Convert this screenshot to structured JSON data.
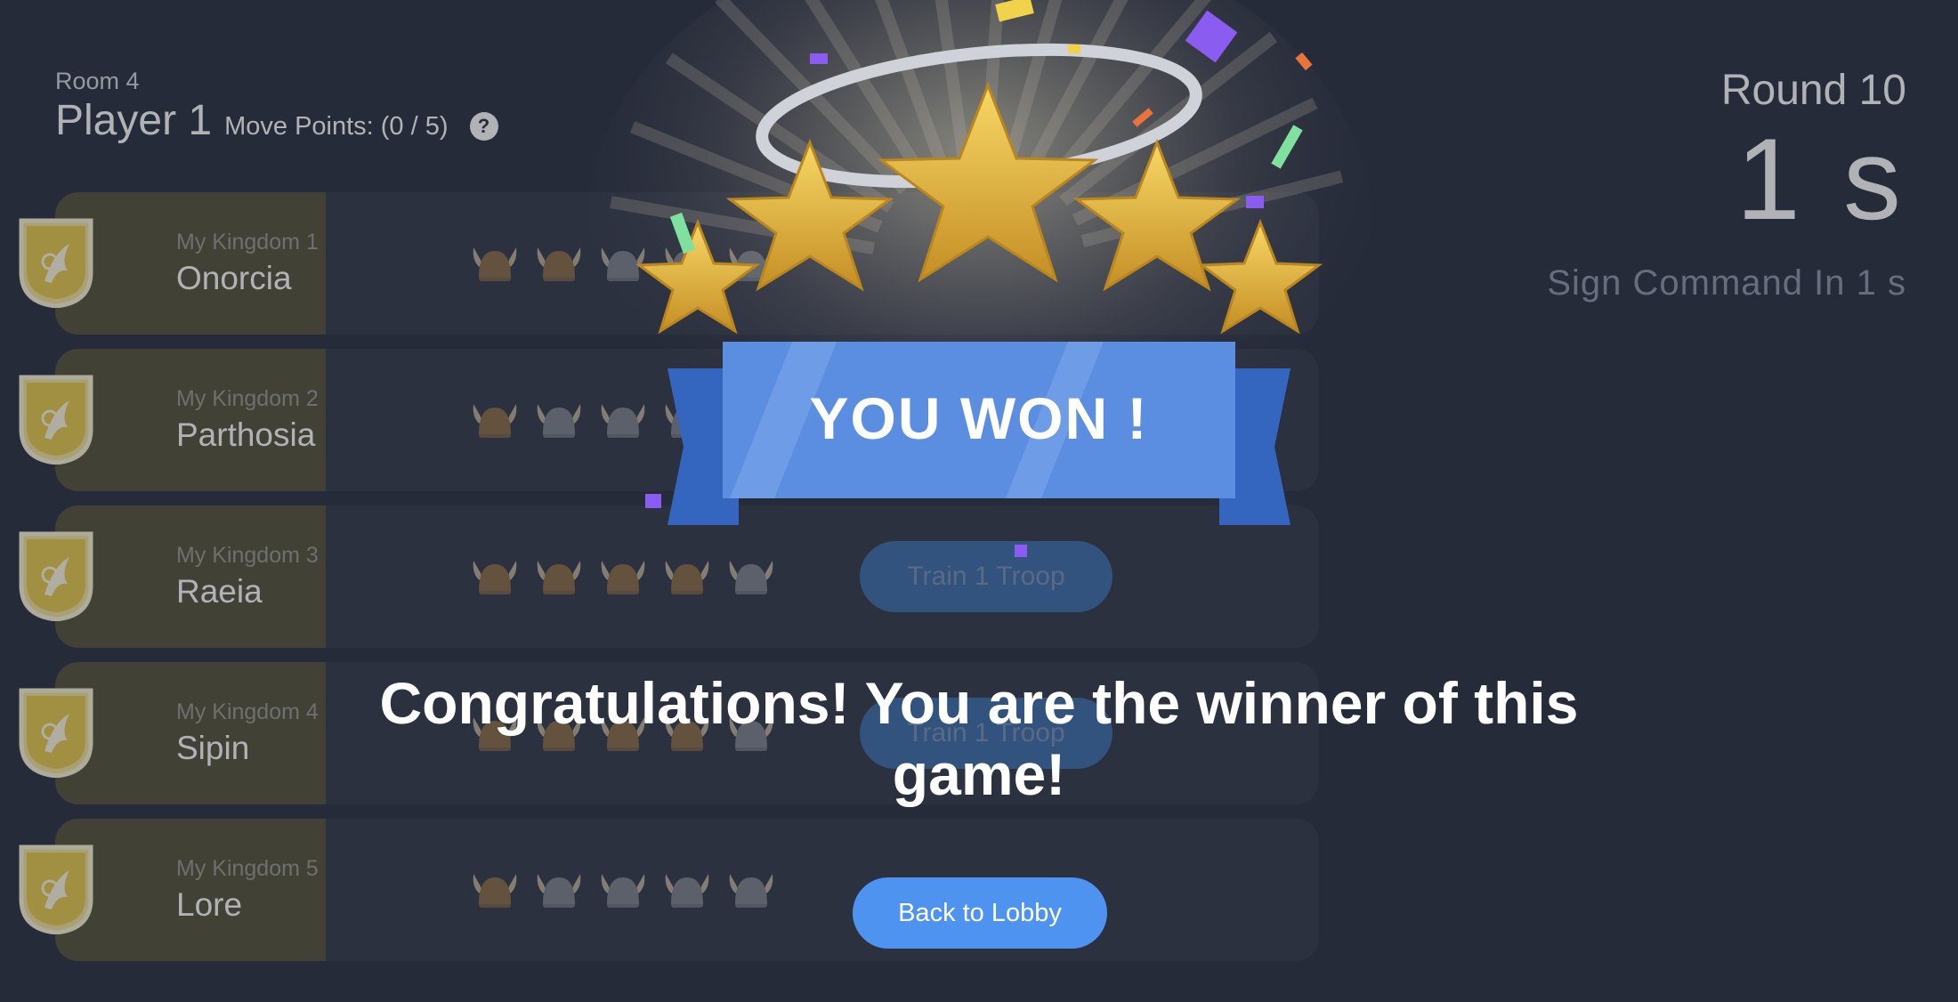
{
  "header": {
    "room": "Room 4",
    "player": "Player 1",
    "move_points": "Move Points: (0 / 5)",
    "help": "?"
  },
  "round_info": {
    "round": "Round 10",
    "timer": "1 s",
    "sign_command": "Sign Command In 1 s"
  },
  "kingdoms": [
    {
      "label": "My Kingdom 1",
      "name": "Onorcia",
      "helmets": [
        "bronze",
        "bronze",
        "silver",
        "silver",
        "silver"
      ],
      "train_label": ""
    },
    {
      "label": "My Kingdom 2",
      "name": "Parthosia",
      "helmets": [
        "bronze",
        "silver",
        "silver",
        "silver",
        "silver"
      ],
      "train_label": ""
    },
    {
      "label": "My Kingdom 3",
      "name": "Raeia",
      "helmets": [
        "bronze",
        "bronze",
        "bronze",
        "bronze",
        "silver"
      ],
      "train_label": "Train 1 Troop"
    },
    {
      "label": "My Kingdom 4",
      "name": "Sipin",
      "helmets": [
        "bronze",
        "bronze",
        "bronze",
        "bronze",
        "silver"
      ],
      "train_label": "Train 1 Troop"
    },
    {
      "label": "My Kingdom 5",
      "name": "Lore",
      "helmets": [
        "bronze",
        "silver",
        "silver",
        "silver",
        "silver"
      ],
      "train_label": ""
    }
  ],
  "overlay": {
    "banner": "YOU WON !",
    "message": "Congratulations! You are the winner of this game!",
    "lobby_button": "Back to Lobby"
  },
  "colors": {
    "background": "#2b3041",
    "crest_gold": "#e8c94e",
    "banner_blue": "#5b8ee0",
    "lobby_blue": "#4f93f1",
    "star_gold": "#e2b33c"
  }
}
